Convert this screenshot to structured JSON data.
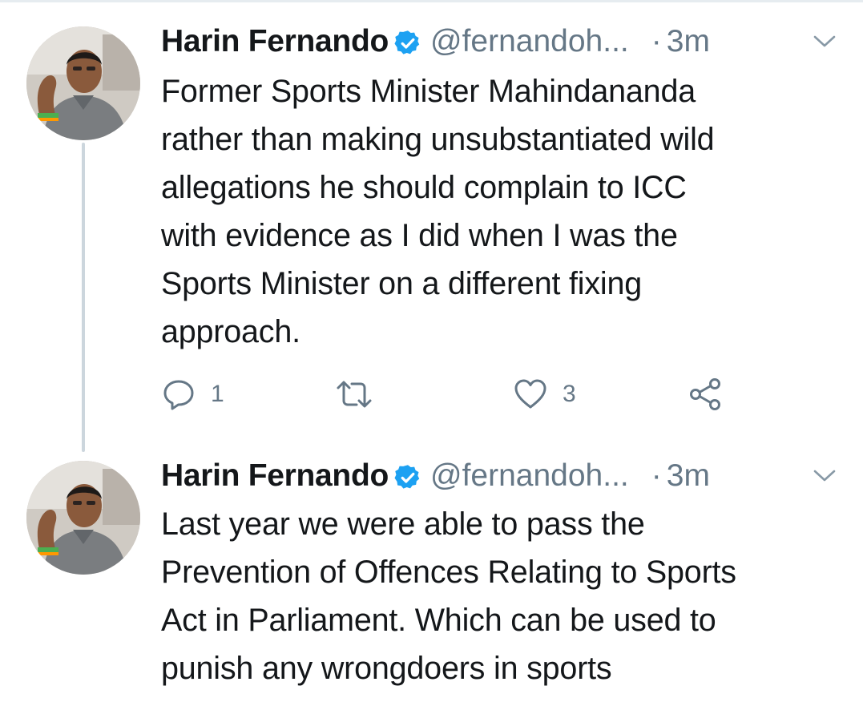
{
  "tweets": [
    {
      "author_name": "Harin Fernando",
      "handle": "@fernandoh...",
      "separator": "·",
      "time": "3m",
      "text": "Former Sports Minister Mahindananda rather than making unsubstantiated wild allegations he should complain to ICC with evidence as I did when I was the Sports Minister on a different fixing approach.",
      "text_lines": [
        "Former Sports Minister Mahindananda",
        "rather than making unsubstantiated wild",
        "allegations he should complain to ICC",
        "with evidence as I did when I was the",
        "Sports Minister on a different fixing",
        "approach."
      ],
      "reply_count": "1",
      "like_count": "3"
    },
    {
      "author_name": "Harin Fernando",
      "handle": "@fernandoh...",
      "separator": "·",
      "time": "3m",
      "text_lines": [
        "Last year we were able to pass the",
        "Prevention of Offences Relating to Sports",
        "Act in Parliament. Which can be used to",
        "punish any wrongdoers in sports"
      ]
    }
  ],
  "icons": {
    "verified": "verified-badge-icon",
    "caret": "chevron-down-icon",
    "reply": "reply-icon",
    "retweet": "retweet-icon",
    "like": "heart-icon",
    "share": "share-icon"
  },
  "colors": {
    "text": "#14171a",
    "secondary": "#657786",
    "verified": "#1da1f2",
    "thread_line": "#ccd6dd"
  }
}
